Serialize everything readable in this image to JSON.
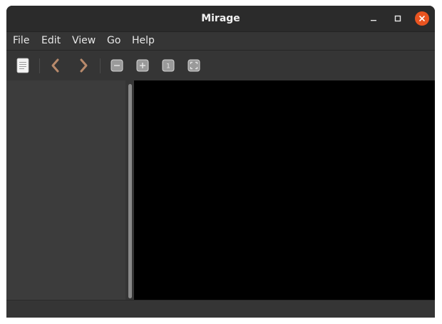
{
  "window": {
    "title": "Mirage"
  },
  "menu": {
    "items": [
      {
        "label": "File"
      },
      {
        "label": "Edit"
      },
      {
        "label": "View"
      },
      {
        "label": "Go"
      },
      {
        "label": "Help"
      }
    ]
  },
  "toolbar": {
    "icons": [
      "document-icon",
      "chevron-left-icon",
      "chevron-right-icon",
      "zoom-out-icon",
      "zoom-in-icon",
      "zoom-fit-icon",
      "zoom-actual-icon"
    ]
  },
  "statusbar": {
    "text": ""
  },
  "colors": {
    "close_button": "#e95420",
    "nav_arrows": "#b88a6c",
    "canvas": "#000000"
  }
}
